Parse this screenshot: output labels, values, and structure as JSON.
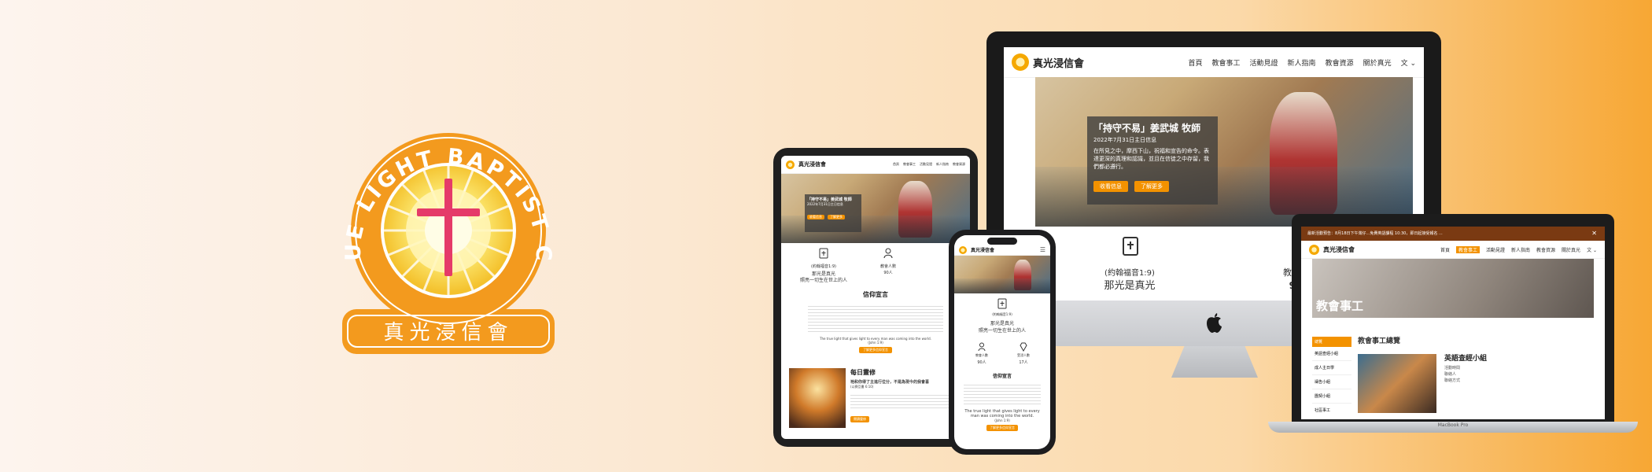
{
  "logo": {
    "ring_text": "S.F. TRUE LIGHT BAPTIST CHURCH",
    "chinese_name": "真光浸信會",
    "colors": {
      "orange": "#f39a1e",
      "light_yellow": "#fff1a8",
      "cross": "#e53a69"
    }
  },
  "site": {
    "brand": "真光浸信會",
    "nav_items": [
      "首頁",
      "教會事工",
      "活動見證",
      "新人指南",
      "教會資源",
      "關於真光",
      "文 ⌄"
    ],
    "hero": {
      "title": "「持守不易」姜武城 牧師",
      "date": "2022年7月31日主日信息",
      "body": "在所見之中，摩西下山，祝福和宣告的命令。表達更深的真理和認識，並且在信徒之中存留，我們都必遵行。",
      "button1": "收看信息",
      "button2": "了解更多"
    },
    "info": {
      "verse_label": "(約翰福音1:9)",
      "verse_text": "那光是真光",
      "verse_full": "照亮一切生在世上的人",
      "attendance_label": "教會人數",
      "attendance_value": "90人",
      "baptism_label": "受浸人數",
      "baptism_value": "17人"
    },
    "statement": {
      "heading": "信仰宣言",
      "english": "The true light that gives light to every man was coming into the world.",
      "reference": "(John 1:9)",
      "button": "了解更多信仰宣言"
    },
    "devotion": {
      "heading": "每日靈修",
      "subtitle": "祂和你得了主進行位分，不是為現今的我會喜",
      "reference": "(以賽亞書 6:10)",
      "button": "閱讀靈修"
    }
  },
  "laptop": {
    "announcement": "最新活動預告：8月18日下午灣仔...免費英語課程 10:30，即日起接受報名 ...",
    "page_title": "教會事工",
    "section_title": "教會事工總覽",
    "sidebar_items": [
      "總覽",
      "英語查經小組",
      "成人主日學",
      "禱告小組",
      "團契小組",
      "社區事工"
    ],
    "group_title": "英語查經小組",
    "group_meta": [
      "活動時間",
      "聯絡人",
      "聯絡方式"
    ],
    "brand_caption": "MacBook Pro"
  }
}
